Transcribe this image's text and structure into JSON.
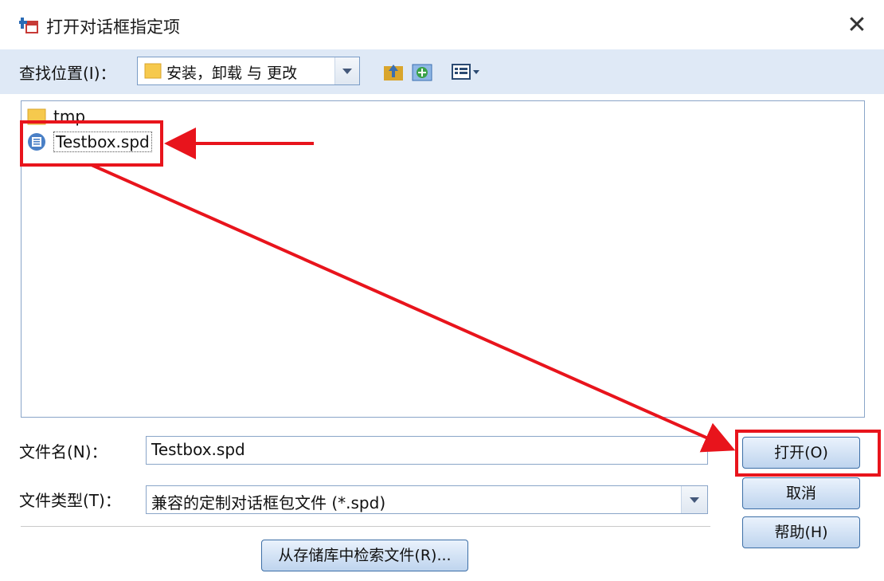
{
  "window": {
    "title": "打开对话框指定项",
    "close_glyph": "✕"
  },
  "toolbar": {
    "lookin_label": "查找位置(I)：",
    "lookin_value": "安装，卸载 与 更改",
    "buttons": [
      "up-folder-icon",
      "new-folder-icon",
      "view-menu-icon"
    ]
  },
  "files": [
    {
      "name": "tmp",
      "icon": "folder-icon",
      "selected": false
    },
    {
      "name": "Testbox.spd",
      "icon": "spd-file-icon",
      "selected": true
    }
  ],
  "filename": {
    "label": "文件名(N)：",
    "value": "Testbox.spd"
  },
  "filetype": {
    "label": "文件类型(T)：",
    "value": "兼容的定制对话框包文件 (*.spd)"
  },
  "buttons": {
    "open": "打开(O)",
    "cancel": "取消",
    "help": "帮助(H)",
    "repository": "从存储库中检索文件(R)..."
  },
  "annotations": {
    "highlight_color": "#e8141c"
  },
  "colors": {
    "toolbar_bg": "#dfe9f6",
    "button_border": "#3c6ea6",
    "folder": "#f6c94d"
  }
}
